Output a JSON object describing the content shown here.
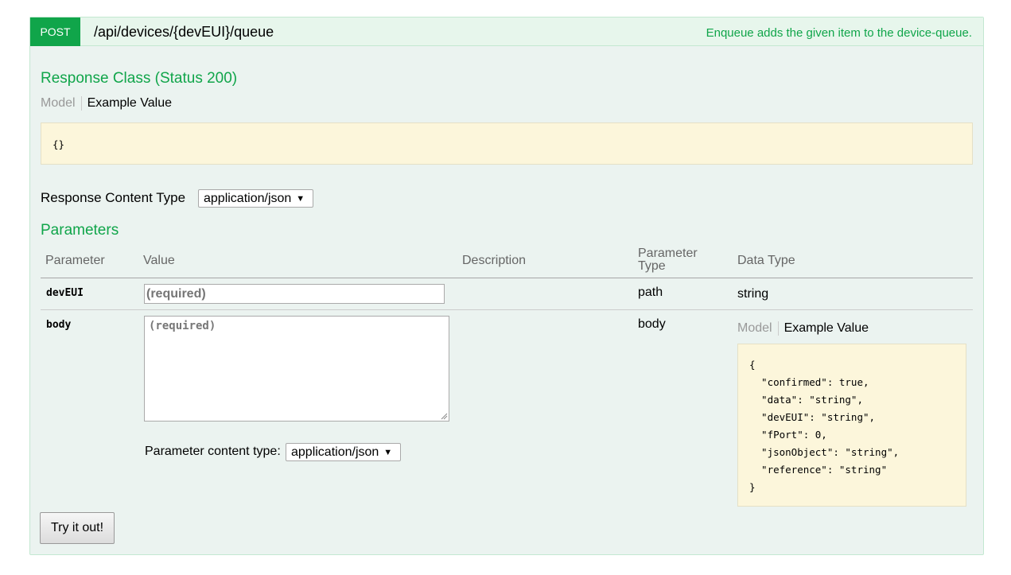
{
  "operation": {
    "method": "POST",
    "path": "/api/devices/{devEUI}/queue",
    "summary": "Enqueue adds the given item to the device-queue."
  },
  "response_class": {
    "title": "Response Class (Status 200)",
    "tab_model": "Model",
    "tab_example": "Example Value",
    "example": "{}"
  },
  "response_content_type": {
    "label": "Response Content Type",
    "selected": "application/json"
  },
  "parameters": {
    "title": "Parameters",
    "headers": {
      "parameter": "Parameter",
      "value": "Value",
      "description": "Description",
      "parameter_type": "Parameter Type",
      "data_type": "Data Type"
    },
    "rows": [
      {
        "name": "devEUI",
        "placeholder": "(required)",
        "description": "",
        "param_type": "path",
        "data_type": "string"
      },
      {
        "name": "body",
        "placeholder": "(required)",
        "description": "",
        "param_type": "body",
        "content_type_label": "Parameter content type:",
        "content_type_selected": "application/json",
        "data_type_tab_model": "Model",
        "data_type_tab_example": "Example Value",
        "example": "{\n  \"confirmed\": true,\n  \"data\": \"string\",\n  \"devEUI\": \"string\",\n  \"fPort\": 0,\n  \"jsonObject\": \"string\",\n  \"reference\": \"string\"\n}"
      }
    ]
  },
  "try_button": "Try it out!",
  "icons": {
    "select_arrow": "caret-down-icon",
    "resize_grip": "resize-grip-icon"
  },
  "colors": {
    "post_green": "#10a54a",
    "panel_bg": "#ebf3f0",
    "example_bg": "#fcf6db"
  }
}
